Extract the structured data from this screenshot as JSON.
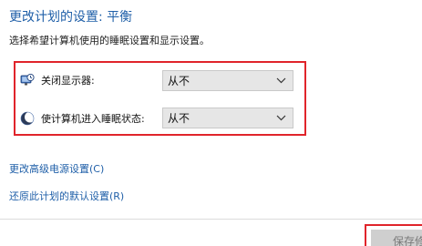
{
  "header": {
    "title": "更改计划的设置: 平衡",
    "subtitle": "选择希望计算机使用的睡眠设置和显示设置。"
  },
  "settings": [
    {
      "icon": "monitor-clock-icon",
      "label": "关闭显示器:",
      "value": "从不"
    },
    {
      "icon": "moon-icon",
      "label": "使计算机进入睡眠状态:",
      "value": "从不"
    }
  ],
  "links": {
    "advanced": "更改高级电源设置(C)",
    "restore": "还原此计划的默认设置(R)"
  },
  "footer": {
    "save_label": "保存修"
  },
  "colors": {
    "title": "#1f5fa8",
    "highlight": "#e0242b",
    "select_bg": "#e6e6e6",
    "button_bg": "#cfcfcf"
  }
}
